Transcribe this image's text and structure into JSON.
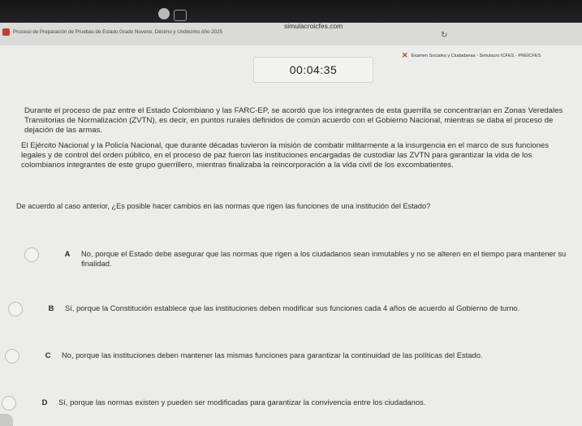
{
  "browser": {
    "address": "simulacroicfes.com",
    "tab_left_title": "Proceso de Preparación de Pruebas de Estado Grado Noveno, Décimo y Undécimo Año 2025",
    "tab_right_title": "Examen Sociales y Ciudadanas - Simulacro ICFES - PREICFES"
  },
  "timer": "00:04:35",
  "passage": {
    "p1": "Durante el proceso de paz entre el Estado Colombiano y las FARC-EP, se acordó que los integrantes de esta guerrilla se concentrarían en Zonas Veredales Transitorias de Normalización (ZVTN), es decir, en puntos rurales definidos de común acuerdo con el Gobierno Nacional, mientras se daba el proceso de dejación de las armas.",
    "p2": "El Ejército Nacional y la Policía Nacional, que durante décadas tuvieron la misión de combatir militarmente a la insurgencia en el marco de sus funciones legales y de control del orden público, en el proceso de paz fueron las instituciones encargadas de custodiar las ZVTN para garantizar la vida de los colombianos integrantes de este grupo guerrillero, mientras finalizaba la reincorporación a la vida civil de los excombatientes."
  },
  "question": "De acuerdo al caso anterior, ¿Es posible hacer cambios en las normas que rigen las funciones de una institución del Estado?",
  "options": [
    {
      "letter": "A",
      "text": "No, porque el Estado debe asegurar que las normas que rigen a los ciudadanos sean inmutables y no se alteren en el tiempo para mantener su finalidad."
    },
    {
      "letter": "B",
      "text": "Sí, porque la Constitución establece que las instituciones deben modificar sus funciones cada 4 años de acuerdo al Gobierno de turno."
    },
    {
      "letter": "C",
      "text": "No, porque las instituciones deben mantener las mismas funciones para garantizar la continuidad de las políticas del Estado."
    },
    {
      "letter": "D",
      "text": "Sí, porque las normas existen y pueden ser modificadas para garantizar la convivencia entre los ciudadanos."
    }
  ]
}
